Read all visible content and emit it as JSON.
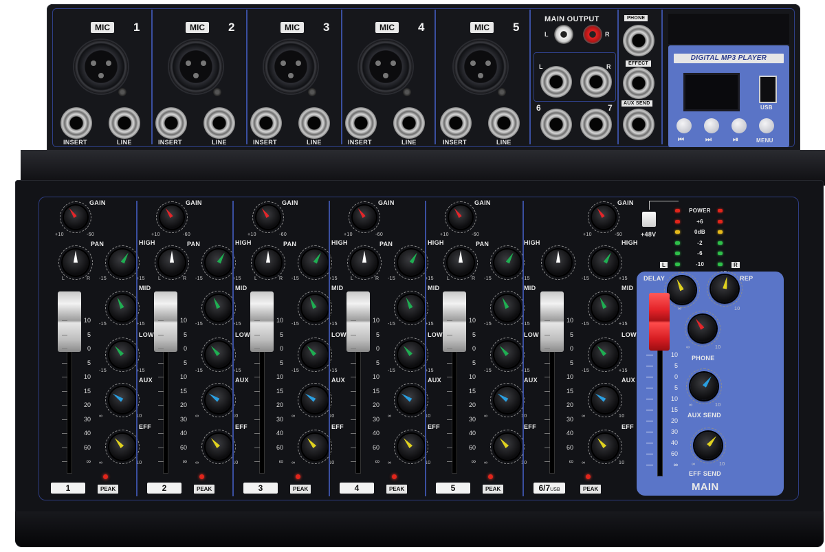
{
  "rear_panel": {
    "channels": [
      {
        "mic_label": "MIC",
        "number": "1",
        "insert_label": "INSERT",
        "line_label": "LINE"
      },
      {
        "mic_label": "MIC",
        "number": "2",
        "insert_label": "INSERT",
        "line_label": "LINE"
      },
      {
        "mic_label": "MIC",
        "number": "3",
        "insert_label": "INSERT",
        "line_label": "LINE"
      },
      {
        "mic_label": "MIC",
        "number": "4",
        "insert_label": "INSERT",
        "line_label": "LINE"
      },
      {
        "mic_label": "MIC",
        "number": "5",
        "insert_label": "INSERT",
        "line_label": "LINE"
      }
    ],
    "main_output": {
      "title": "MAIN OUTPUT",
      "left": "L",
      "right": "R",
      "left2": "L",
      "right2": "R",
      "ch6": "6",
      "ch7": "7"
    },
    "sends": {
      "phone": "PHONE",
      "effect": "EFFECT",
      "aux_send": "AUX SEND"
    },
    "mp3": {
      "title": "DIGITAL MP3 PLAYER",
      "usb": "USB",
      "prev": "⏮",
      "next": "⏭",
      "play": "⏯",
      "menu": "MENU"
    }
  },
  "strips": [
    {
      "id": "1",
      "gain": "GAIN",
      "pan": "PAN",
      "high": "HIGH",
      "mid": "MID",
      "low": "LOW",
      "aux": "AUX",
      "eff": "EFF",
      "peak": "PEAK"
    },
    {
      "id": "2",
      "gain": "GAIN",
      "pan": "PAN",
      "high": "HIGH",
      "mid": "MID",
      "low": "LOW",
      "aux": "AUX",
      "eff": "EFF",
      "peak": "PEAK"
    },
    {
      "id": "3",
      "gain": "GAIN",
      "pan": "PAN",
      "high": "HIGH",
      "mid": "MID",
      "low": "LOW",
      "aux": "AUX",
      "eff": "EFF",
      "peak": "PEAK"
    },
    {
      "id": "4",
      "gain": "GAIN",
      "pan": "PAN",
      "high": "HIGH",
      "mid": "MID",
      "low": "LOW",
      "aux": "AUX",
      "eff": "EFF",
      "peak": "PEAK"
    },
    {
      "id": "5",
      "gain": "GAIN",
      "pan": "PAN",
      "high": "HIGH",
      "mid": "MID",
      "low": "LOW",
      "aux": "AUX",
      "eff": "EFF",
      "peak": "PEAK"
    },
    {
      "id": "6/7",
      "id_suffix": "USB",
      "gain": "GAIN",
      "pan": "",
      "high": "HIGH",
      "mid": "MID",
      "low": "LOW",
      "aux": "AUX",
      "eff": "EFF",
      "peak": "PEAK"
    }
  ],
  "knob_scales": {
    "gain_min": "+10",
    "gain_max": "-60",
    "eq_min": "-15",
    "eq_max": "+15",
    "send_min": "∞",
    "send_max": "10",
    "pan_l": "L",
    "pan_r": "R"
  },
  "fader_scale": [
    "10",
    "5",
    "0",
    "5",
    "10",
    "15",
    "20",
    "30",
    "40",
    "60",
    "∞"
  ],
  "master": {
    "phantom": "+48V",
    "meter_labels": [
      "POWER",
      "+6",
      "0dB",
      "-2",
      "-6",
      "-10"
    ],
    "meter_l": "L",
    "meter_r": "R",
    "delay": "DELAY",
    "rep": "REP",
    "phone": "PHONE",
    "aux_send": "AUX SEND",
    "eff_send": "EFF SEND",
    "title": "MAIN",
    "scale_min": "∞",
    "scale_max": "10"
  },
  "colors": {
    "gain": "#e3262a",
    "eq": "#1fae52",
    "aux": "#2a9ee0",
    "eff": "#e0d21f",
    "pan": "#ffffff",
    "panel_blue": "#5a75c8",
    "fader_red": "#e32228"
  }
}
